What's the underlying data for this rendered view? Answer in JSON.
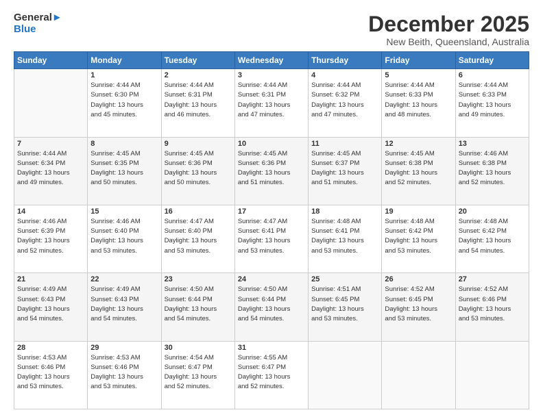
{
  "logo": {
    "line1": "General",
    "line2": "Blue"
  },
  "title": "December 2025",
  "location": "New Beith, Queensland, Australia",
  "weekdays": [
    "Sunday",
    "Monday",
    "Tuesday",
    "Wednesday",
    "Thursday",
    "Friday",
    "Saturday"
  ],
  "weeks": [
    [
      {
        "day": "",
        "info": ""
      },
      {
        "day": "1",
        "info": "Sunrise: 4:44 AM\nSunset: 6:30 PM\nDaylight: 13 hours\nand 45 minutes."
      },
      {
        "day": "2",
        "info": "Sunrise: 4:44 AM\nSunset: 6:31 PM\nDaylight: 13 hours\nand 46 minutes."
      },
      {
        "day": "3",
        "info": "Sunrise: 4:44 AM\nSunset: 6:31 PM\nDaylight: 13 hours\nand 47 minutes."
      },
      {
        "day": "4",
        "info": "Sunrise: 4:44 AM\nSunset: 6:32 PM\nDaylight: 13 hours\nand 47 minutes."
      },
      {
        "day": "5",
        "info": "Sunrise: 4:44 AM\nSunset: 6:33 PM\nDaylight: 13 hours\nand 48 minutes."
      },
      {
        "day": "6",
        "info": "Sunrise: 4:44 AM\nSunset: 6:33 PM\nDaylight: 13 hours\nand 49 minutes."
      }
    ],
    [
      {
        "day": "7",
        "info": "Sunrise: 4:44 AM\nSunset: 6:34 PM\nDaylight: 13 hours\nand 49 minutes."
      },
      {
        "day": "8",
        "info": "Sunrise: 4:45 AM\nSunset: 6:35 PM\nDaylight: 13 hours\nand 50 minutes."
      },
      {
        "day": "9",
        "info": "Sunrise: 4:45 AM\nSunset: 6:36 PM\nDaylight: 13 hours\nand 50 minutes."
      },
      {
        "day": "10",
        "info": "Sunrise: 4:45 AM\nSunset: 6:36 PM\nDaylight: 13 hours\nand 51 minutes."
      },
      {
        "day": "11",
        "info": "Sunrise: 4:45 AM\nSunset: 6:37 PM\nDaylight: 13 hours\nand 51 minutes."
      },
      {
        "day": "12",
        "info": "Sunrise: 4:45 AM\nSunset: 6:38 PM\nDaylight: 13 hours\nand 52 minutes."
      },
      {
        "day": "13",
        "info": "Sunrise: 4:46 AM\nSunset: 6:38 PM\nDaylight: 13 hours\nand 52 minutes."
      }
    ],
    [
      {
        "day": "14",
        "info": "Sunrise: 4:46 AM\nSunset: 6:39 PM\nDaylight: 13 hours\nand 52 minutes."
      },
      {
        "day": "15",
        "info": "Sunrise: 4:46 AM\nSunset: 6:40 PM\nDaylight: 13 hours\nand 53 minutes."
      },
      {
        "day": "16",
        "info": "Sunrise: 4:47 AM\nSunset: 6:40 PM\nDaylight: 13 hours\nand 53 minutes."
      },
      {
        "day": "17",
        "info": "Sunrise: 4:47 AM\nSunset: 6:41 PM\nDaylight: 13 hours\nand 53 minutes."
      },
      {
        "day": "18",
        "info": "Sunrise: 4:48 AM\nSunset: 6:41 PM\nDaylight: 13 hours\nand 53 minutes."
      },
      {
        "day": "19",
        "info": "Sunrise: 4:48 AM\nSunset: 6:42 PM\nDaylight: 13 hours\nand 53 minutes."
      },
      {
        "day": "20",
        "info": "Sunrise: 4:48 AM\nSunset: 6:42 PM\nDaylight: 13 hours\nand 54 minutes."
      }
    ],
    [
      {
        "day": "21",
        "info": "Sunrise: 4:49 AM\nSunset: 6:43 PM\nDaylight: 13 hours\nand 54 minutes."
      },
      {
        "day": "22",
        "info": "Sunrise: 4:49 AM\nSunset: 6:43 PM\nDaylight: 13 hours\nand 54 minutes."
      },
      {
        "day": "23",
        "info": "Sunrise: 4:50 AM\nSunset: 6:44 PM\nDaylight: 13 hours\nand 54 minutes."
      },
      {
        "day": "24",
        "info": "Sunrise: 4:50 AM\nSunset: 6:44 PM\nDaylight: 13 hours\nand 54 minutes."
      },
      {
        "day": "25",
        "info": "Sunrise: 4:51 AM\nSunset: 6:45 PM\nDaylight: 13 hours\nand 53 minutes."
      },
      {
        "day": "26",
        "info": "Sunrise: 4:52 AM\nSunset: 6:45 PM\nDaylight: 13 hours\nand 53 minutes."
      },
      {
        "day": "27",
        "info": "Sunrise: 4:52 AM\nSunset: 6:46 PM\nDaylight: 13 hours\nand 53 minutes."
      }
    ],
    [
      {
        "day": "28",
        "info": "Sunrise: 4:53 AM\nSunset: 6:46 PM\nDaylight: 13 hours\nand 53 minutes."
      },
      {
        "day": "29",
        "info": "Sunrise: 4:53 AM\nSunset: 6:46 PM\nDaylight: 13 hours\nand 53 minutes."
      },
      {
        "day": "30",
        "info": "Sunrise: 4:54 AM\nSunset: 6:47 PM\nDaylight: 13 hours\nand 52 minutes."
      },
      {
        "day": "31",
        "info": "Sunrise: 4:55 AM\nSunset: 6:47 PM\nDaylight: 13 hours\nand 52 minutes."
      },
      {
        "day": "",
        "info": ""
      },
      {
        "day": "",
        "info": ""
      },
      {
        "day": "",
        "info": ""
      }
    ]
  ]
}
